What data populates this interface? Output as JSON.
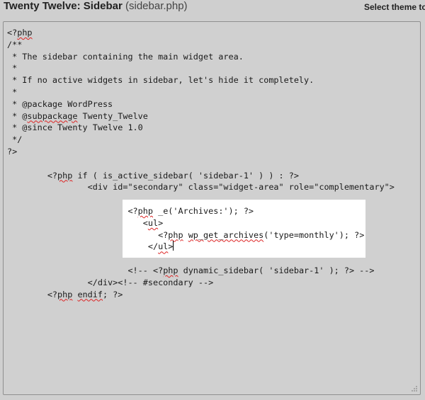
{
  "header": {
    "title_bold": "Twenty Twelve: Sidebar",
    "title_file": "(sidebar.php)",
    "select_theme_label": "Select theme to"
  },
  "editor": {
    "lines": [
      "<?php",
      "/**",
      " * The sidebar containing the main widget area.",
      " *",
      " * If no active widgets in sidebar, let's hide it completely.",
      " *",
      " * @package WordPress",
      " * @subpackage Twenty_Twelve",
      " * @since Twenty Twelve 1.0",
      " */",
      "?>",
      "",
      "        <?php if ( is_active_sidebar( 'sidebar-1' ) ) : ?>",
      "                <div id=\"secondary\" class=\"widget-area\" role=\"complementary\">",
      "",
      "                        <?php _e('Archives:'); ?>",
      "                           <ul>",
      "                              <?php wp_get_archives('type=monthly'); ?>",
      "                            </ul>",
      "",
      "                        <!-- <?php dynamic_sidebar( 'sidebar-1' ); ?> -->",
      "                </div><!-- #secondary -->",
      "        <?php endif; ?>"
    ]
  },
  "colors": {
    "background": "#cfcfcf",
    "editor_background": "#d0d0d0",
    "selection": "#ffffff",
    "spellcheck": "#dd2222"
  },
  "icons": {
    "resize": "resize-grip-icon"
  }
}
